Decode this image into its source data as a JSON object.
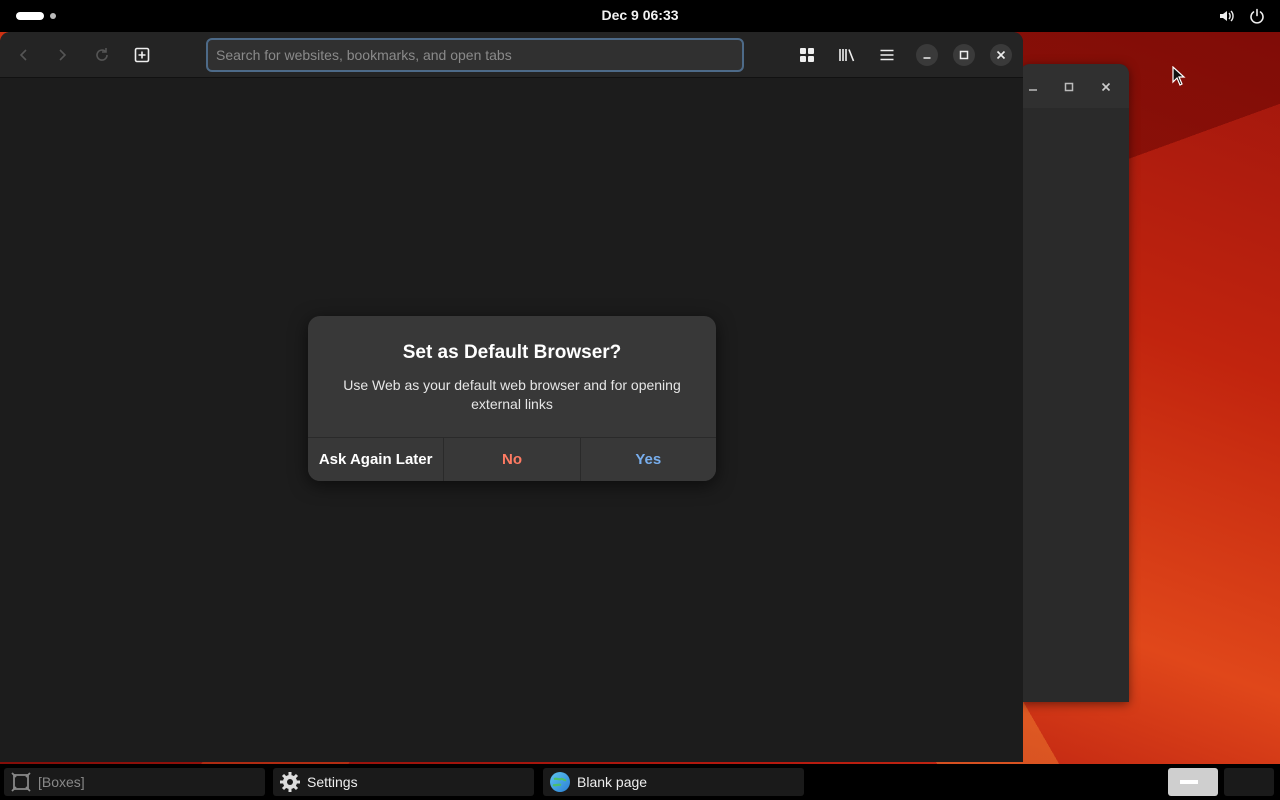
{
  "topbar": {
    "clock": "Dec 9  06:33",
    "icons": [
      "volume-icon",
      "power-icon"
    ]
  },
  "browser": {
    "url_placeholder": "Search for websites, bookmarks, and open tabs",
    "toolbar_icons": [
      "back-icon",
      "forward-icon",
      "reload-icon",
      "new-tab-icon",
      "tab-overview-icon",
      "library-icon",
      "menu-icon",
      "minimize-icon",
      "maximize-icon",
      "close-icon"
    ]
  },
  "dialog": {
    "title": "Set as Default Browser?",
    "body": "Use Web as your default web browser and for opening external links",
    "buttons": {
      "later": "Ask Again Later",
      "no": "No",
      "yes": "Yes"
    }
  },
  "taskbar": {
    "tasks": [
      {
        "label": "[Boxes]",
        "icon": "boxes-icon"
      },
      {
        "label": "Settings",
        "icon": "gear-icon"
      },
      {
        "label": "Blank page",
        "icon": "globe-icon"
      }
    ]
  },
  "colors": {
    "accent": "#78aeed",
    "destructive": "#ff7b63",
    "dialog_bg": "#383838",
    "window_bg": "#1c1c1c"
  }
}
